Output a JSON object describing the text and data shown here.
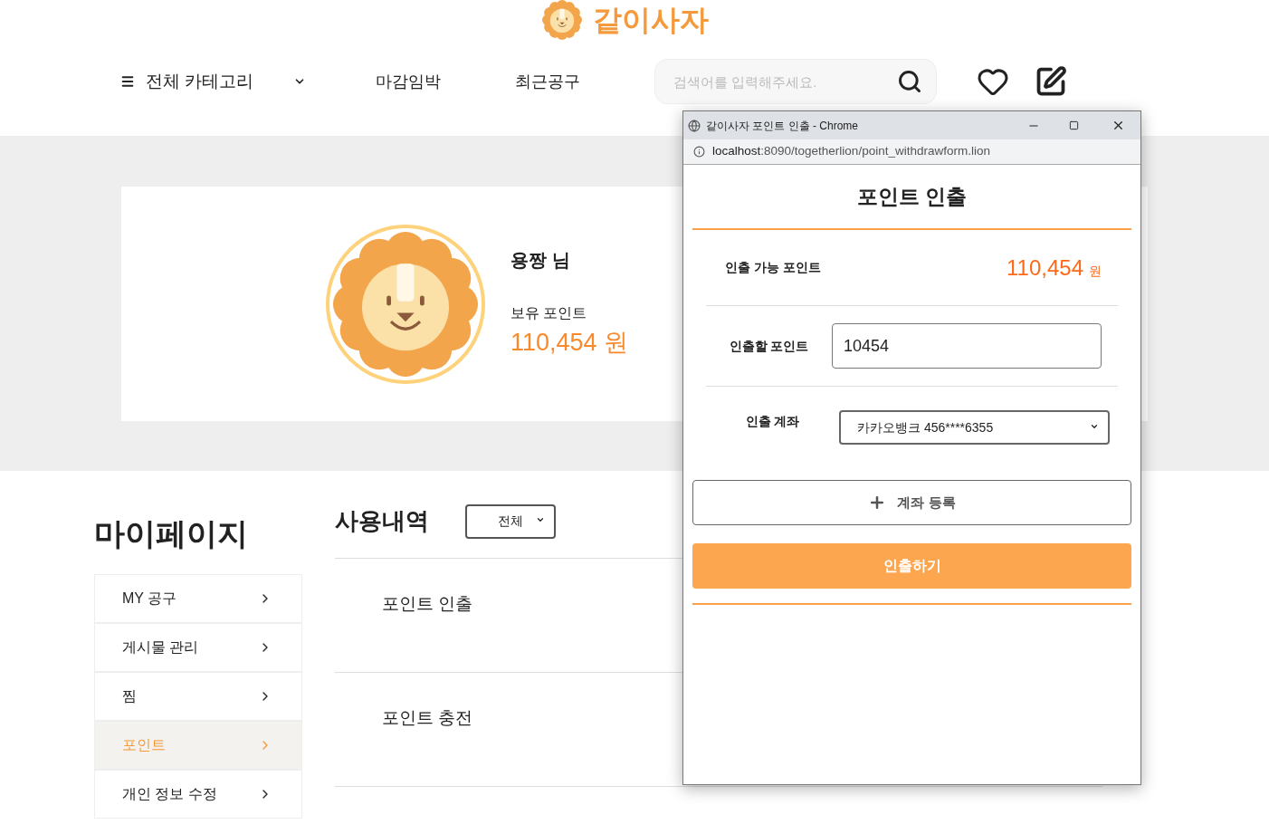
{
  "header": {
    "logo_text": "같이사자",
    "nav": [
      {
        "label": "전체 카테고리",
        "kind": "category"
      },
      {
        "label": "마감임박",
        "kind": "link"
      },
      {
        "label": "최근공구",
        "kind": "link"
      }
    ],
    "search": {
      "placeholder": "검색어를 입력해주세요."
    }
  },
  "profile": {
    "name": "용짱 님",
    "points_label": "보유 포인트",
    "points": "110,454 원"
  },
  "mypage": {
    "title": "마이페이지",
    "menu": [
      {
        "label": "MY 공구",
        "selected": false
      },
      {
        "label": "게시물 관리",
        "selected": false
      },
      {
        "label": "찜",
        "selected": false
      },
      {
        "label": "포인트",
        "selected": true
      },
      {
        "label": "개인 정보 수정",
        "selected": false
      }
    ]
  },
  "history": {
    "title": "사용내역",
    "filter": "전체",
    "rows": [
      {
        "type": "포인트 인출"
      },
      {
        "type": "포인트 충전"
      }
    ]
  },
  "popup": {
    "window_title": "같이사자 포인트 인출 - Chrome",
    "url_host": "localhost",
    "url_rest": ":8090/togetherlion/point_withdrawform.lion",
    "heading": "포인트 인출",
    "available_label": "인출 가능 포인트",
    "available_amount": "110,454",
    "available_unit": "원",
    "amount_label": "인출할 포인트",
    "amount_value": "10454",
    "account_label": "인출 계좌",
    "account_value": "카카오뱅크 456****6355",
    "add_account": "계좌 등록",
    "submit": "인출하기"
  }
}
